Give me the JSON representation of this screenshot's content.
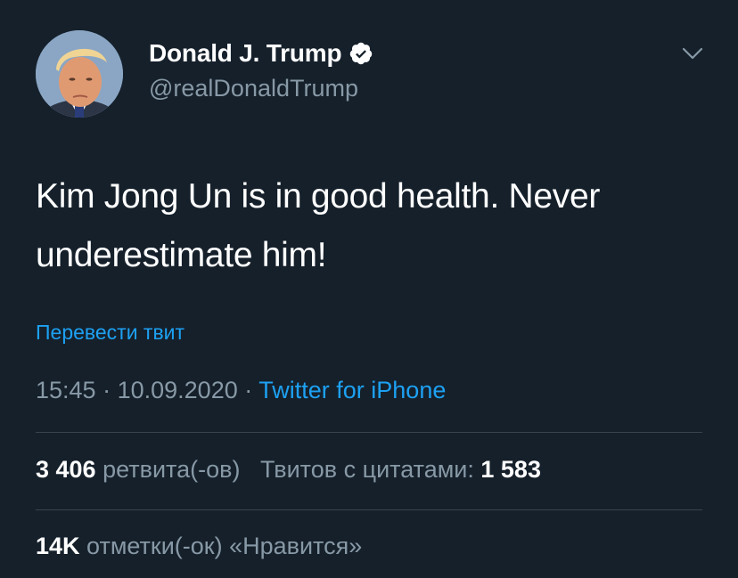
{
  "user": {
    "name": "Donald J. Trump",
    "handle": "@realDonaldTrump",
    "verified": true
  },
  "tweet": {
    "line1": "Kim Jong Un is in good health. Never",
    "line2": "underestimate him!",
    "translate_label": "Перевести твит",
    "time": "15:45",
    "date": "10.09.2020",
    "source": "Twitter for iPhone"
  },
  "stats": {
    "retweets_count": "3 406",
    "retweets_label": "ретвита(-ов)",
    "quotes_label": "Твитов с цитатами:",
    "quotes_count": "1 583",
    "likes_count": "14K",
    "likes_label": "отметки(-ок) «Нравится»"
  },
  "icons": {
    "verified": "verified-badge-icon",
    "menu": "chevron-down-icon"
  },
  "colors": {
    "background": "#15202b",
    "text": "#ffffff",
    "secondary": "#8899a6",
    "accent": "#1da1f2",
    "divider": "#38444d"
  }
}
